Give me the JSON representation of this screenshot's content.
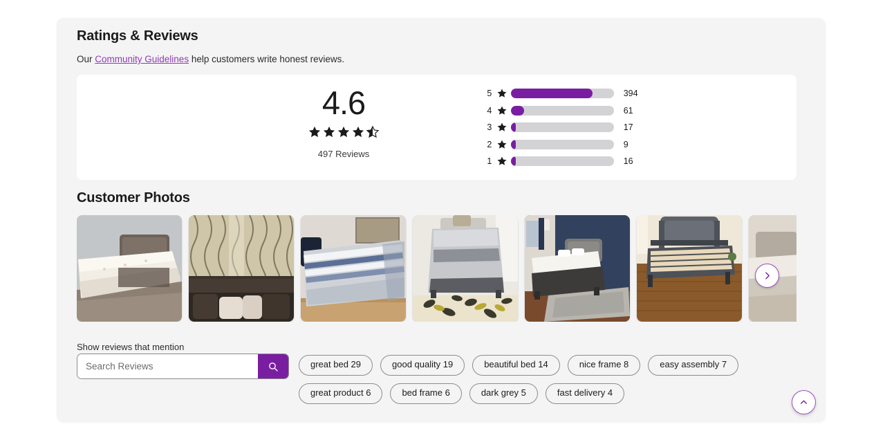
{
  "section": {
    "title": "Ratings & Reviews",
    "guidelines_prefix": "Our ",
    "guidelines_link": "Community Guidelines",
    "guidelines_suffix": " help customers write honest reviews."
  },
  "summary": {
    "average_score": "4.6",
    "stars_filled": 4.5,
    "reviews_count_label": "497 Reviews",
    "total_reviews": 497
  },
  "histogram": {
    "rows": [
      {
        "stars": "5",
        "count": "394",
        "value": 394,
        "percent": 79.3
      },
      {
        "stars": "4",
        "count": "61",
        "value": 61,
        "percent": 12.3
      },
      {
        "stars": "3",
        "count": "17",
        "value": 17,
        "percent": 3.4
      },
      {
        "stars": "2",
        "count": "9",
        "value": 9,
        "percent": 1.8
      },
      {
        "stars": "1",
        "count": "16",
        "value": 16,
        "percent": 3.2
      }
    ],
    "bar_fill_color": "#7a1ea1",
    "bar_track_color": "#d3d3d6"
  },
  "photos": {
    "title": "Customer Photos",
    "next_icon": "chevron-right-icon",
    "items": [
      {
        "alt": "grey upholstered bed with white pillow-top mattress in grey room"
      },
      {
        "alt": "dark tufted headboard against patterned curtain wall with pillows"
      },
      {
        "alt": "bed with blue and white striped comforter on wood floor"
      },
      {
        "alt": "grey bed with pillows on yellow and black leaf patterned rug"
      },
      {
        "alt": "grey bed with white mattress in navy accent wall bedroom with rug"
      },
      {
        "alt": "grey platform bed frame with wooden slats on hardwood floor"
      },
      {
        "alt": "partial photo of bedroom with grey bed"
      }
    ]
  },
  "search": {
    "label": "Show reviews that mention",
    "placeholder": "Search Reviews",
    "value": "",
    "button_icon": "search-icon",
    "button_color": "#7a1ea1"
  },
  "chips": [
    {
      "label": "great bed 29"
    },
    {
      "label": "good quality 19"
    },
    {
      "label": "beautiful bed 14"
    },
    {
      "label": "nice frame 8"
    },
    {
      "label": "easy assembly 7"
    },
    {
      "label": "great product 6"
    },
    {
      "label": "bed frame 6"
    },
    {
      "label": "dark grey 5"
    },
    {
      "label": "fast delivery 4"
    }
  ],
  "scroll_top": {
    "icon": "chevron-up-icon"
  },
  "colors": {
    "accent_purple": "#7a1ea1",
    "link_purple": "#8f3ab5",
    "card_bg": "#f4f4f4",
    "page_bg": "#ffffff"
  }
}
